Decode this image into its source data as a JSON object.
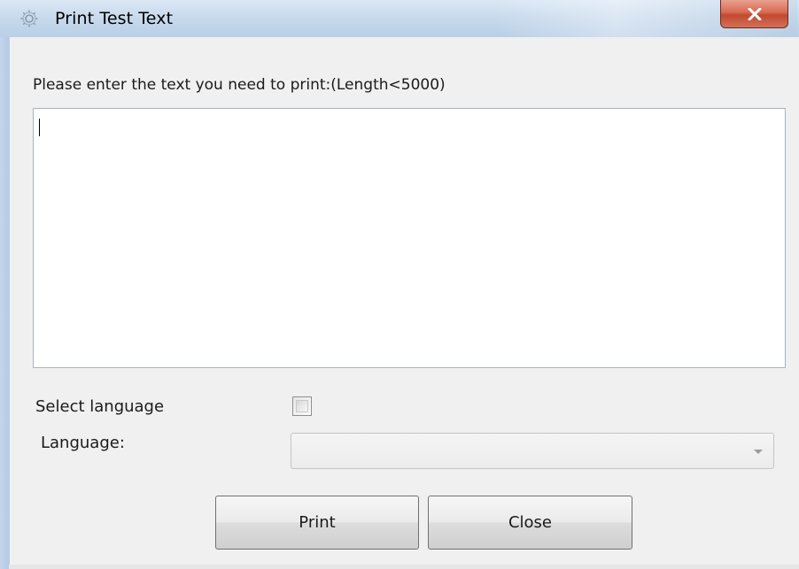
{
  "window": {
    "title": "Print Test Text",
    "icon": "gear-icon",
    "close_icon": "close-icon",
    "colors": {
      "titlebar": "#c7d9ec",
      "close_button": "#d86a52",
      "client_background": "#f0f0f0"
    }
  },
  "form": {
    "prompt_label": "Please enter the text you need to print:(Length<5000)",
    "text_value": "",
    "select_language_label": "Select language",
    "select_language_checked": false,
    "language_label": "Language:",
    "language_value": ""
  },
  "buttons": {
    "print_label": "Print",
    "close_label": "Close"
  }
}
